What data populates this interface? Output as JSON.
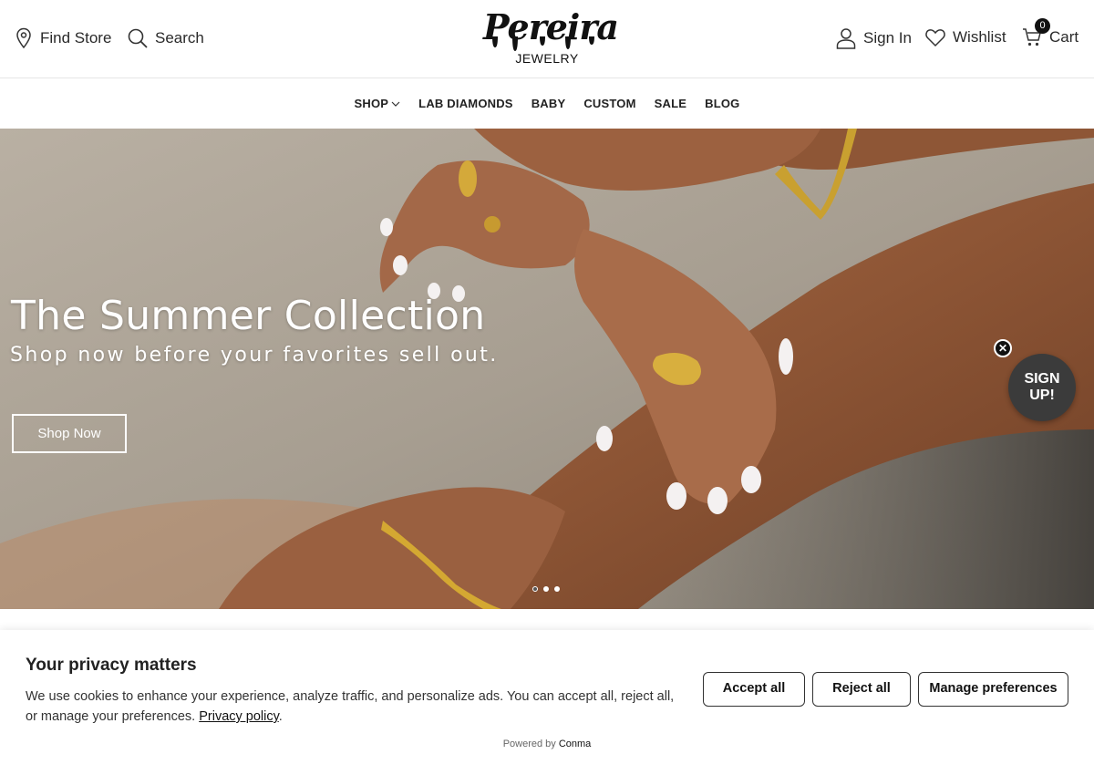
{
  "header": {
    "find_store": "Find Store",
    "search": "Search",
    "logo_script": "Pereira",
    "logo_sub": "JEWELRY",
    "sign_in": "Sign In",
    "wishlist": "Wishlist",
    "cart": "Cart",
    "cart_count": "0"
  },
  "nav": {
    "items": [
      "SHOP",
      "LAB DIAMONDS",
      "BABY",
      "CUSTOM",
      "SALE",
      "BLOG"
    ]
  },
  "hero": {
    "title": "The Summer Collection",
    "subtitle": "Shop now before your favorites sell out.",
    "button": "Shop Now",
    "slides": 3,
    "active_slide": 1
  },
  "signup": {
    "line1": "SIGN",
    "line2": "UP!",
    "close": "✕"
  },
  "cookie": {
    "title": "Your privacy matters",
    "text": "We use cookies to enhance your experience, analyze traffic, and personalize ads. You can accept all, reject all, or manage your preferences.",
    "link": "Privacy policy",
    "accept": "Accept all",
    "reject": "Reject all",
    "manage": "Manage preferences",
    "powered_prefix": "Powered by",
    "powered_brand": "Conma"
  }
}
